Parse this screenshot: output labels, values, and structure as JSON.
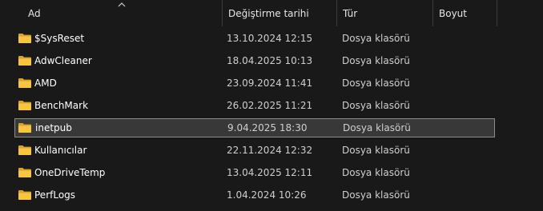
{
  "columns": {
    "name": "Ad",
    "date": "Değiştirme tarihi",
    "type": "Tür",
    "size": "Boyut"
  },
  "sort": {
    "column": "name",
    "direction": "ascending",
    "icon": "chevron-up-icon"
  },
  "colors": {
    "background": "#191919",
    "selected_background": "#383838",
    "selected_border": "#8c8c8c",
    "folder": "#f7c541"
  },
  "rows": [
    {
      "name": "$SysReset",
      "date": "13.10.2024 12:15",
      "type": "Dosya klasörü",
      "size": "",
      "icon": "folder-icon",
      "selected": false
    },
    {
      "name": "AdwCleaner",
      "date": "18.04.2025 10:13",
      "type": "Dosya klasörü",
      "size": "",
      "icon": "folder-icon",
      "selected": false
    },
    {
      "name": "AMD",
      "date": "23.09.2024 11:41",
      "type": "Dosya klasörü",
      "size": "",
      "icon": "folder-icon",
      "selected": false
    },
    {
      "name": "BenchMark",
      "date": "26.02.2025 11:21",
      "type": "Dosya klasörü",
      "size": "",
      "icon": "folder-icon",
      "selected": false
    },
    {
      "name": "inetpub",
      "date": "9.04.2025 18:30",
      "type": "Dosya klasörü",
      "size": "",
      "icon": "folder-icon",
      "selected": true
    },
    {
      "name": "Kullanıcılar",
      "date": "22.11.2024 12:32",
      "type": "Dosya klasörü",
      "size": "",
      "icon": "folder-icon",
      "selected": false
    },
    {
      "name": "OneDriveTemp",
      "date": "13.04.2025 12:11",
      "type": "Dosya klasörü",
      "size": "",
      "icon": "folder-icon",
      "selected": false
    },
    {
      "name": "PerfLogs",
      "date": "1.04.2024 10:26",
      "type": "Dosya klasörü",
      "size": "",
      "icon": "folder-icon",
      "selected": false
    }
  ]
}
